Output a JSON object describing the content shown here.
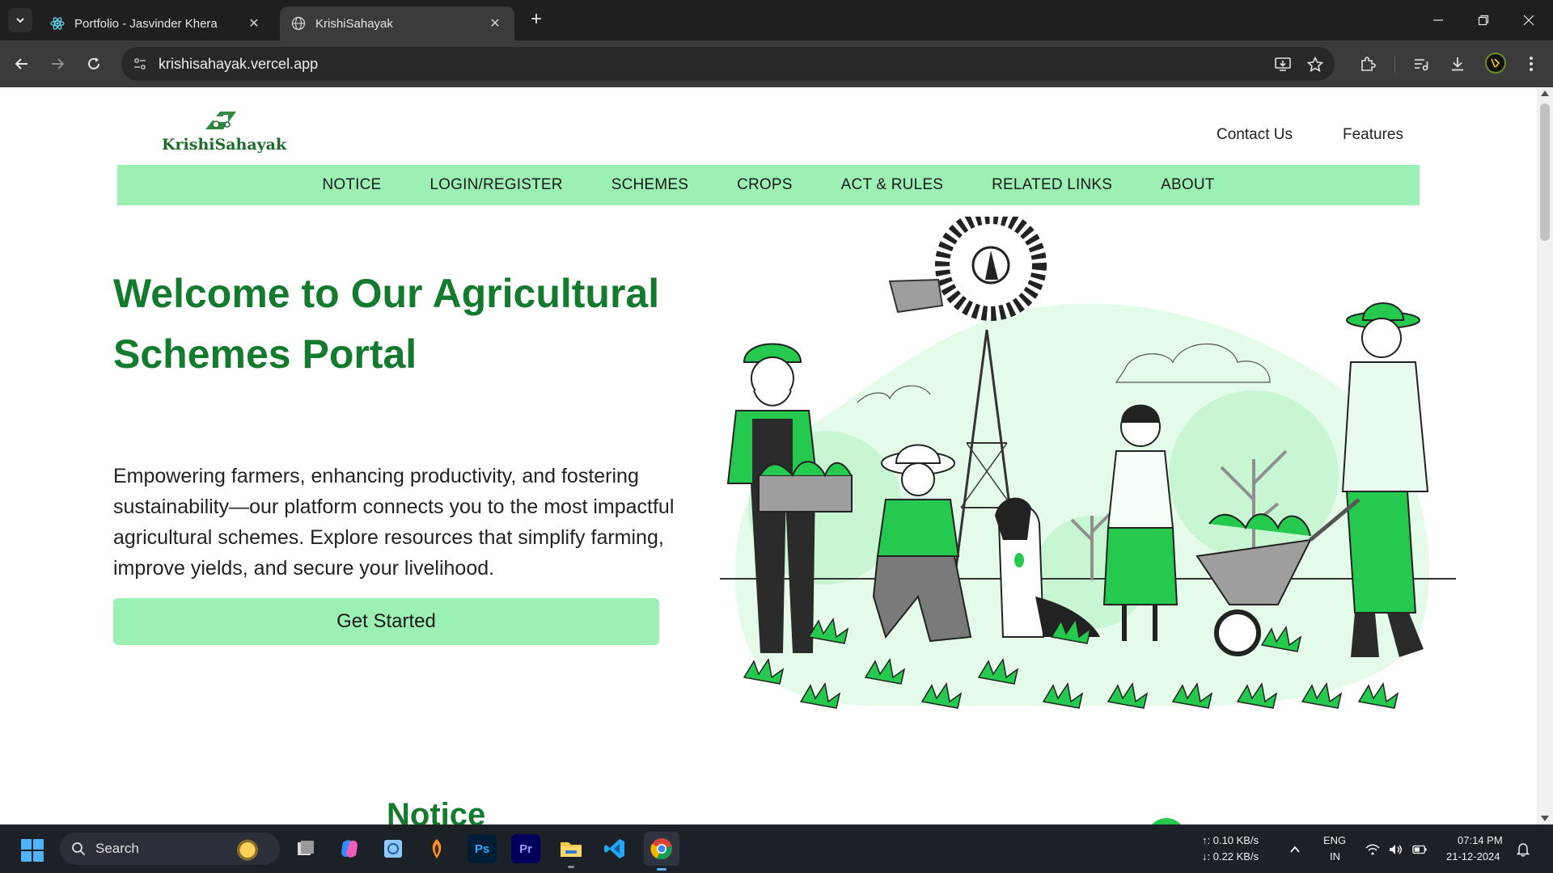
{
  "browser": {
    "tabs": [
      {
        "title": "Portfolio - Jasvinder Khera",
        "active": false
      },
      {
        "title": "KrishiSahayak",
        "active": true
      }
    ],
    "url": "krishisahayak.vercel.app"
  },
  "site": {
    "logo_text": "KrishiSahayak",
    "top_links": [
      "Contact Us",
      "Features"
    ],
    "nav": [
      "NOTICE",
      "LOGIN/REGISTER",
      "SCHEMES",
      "CROPS",
      "ACT & RULES",
      "RELATED LINKS",
      "ABOUT"
    ],
    "hero": {
      "title": "Welcome to Our Agricultural Schemes Portal",
      "description": "Empowering farmers, enhancing productivity, and fostering sustainability—our platform connects you to the most impactful agricultural schemes. Explore resources that simplify farming, improve yields, and secure your livelihood.",
      "cta": "Get Started"
    },
    "next_section_title": "Notice",
    "colors": {
      "brand_green": "#137a2e",
      "nav_bg": "#9cf0b3",
      "accent_green": "#25c94d"
    }
  },
  "taskbar": {
    "search_label": "Search",
    "apps": [
      "file-explorer",
      "copilot",
      "photos",
      "fl-studio",
      "photoshop",
      "premiere-pro",
      "folder",
      "vscode",
      "chrome"
    ],
    "net_up": "↑: 0.10 KB/s",
    "net_down": "↓: 0.22 KB/s",
    "lang_1": "ENG",
    "lang_2": "IN",
    "time": "07:14 PM",
    "date": "21-12-2024"
  }
}
